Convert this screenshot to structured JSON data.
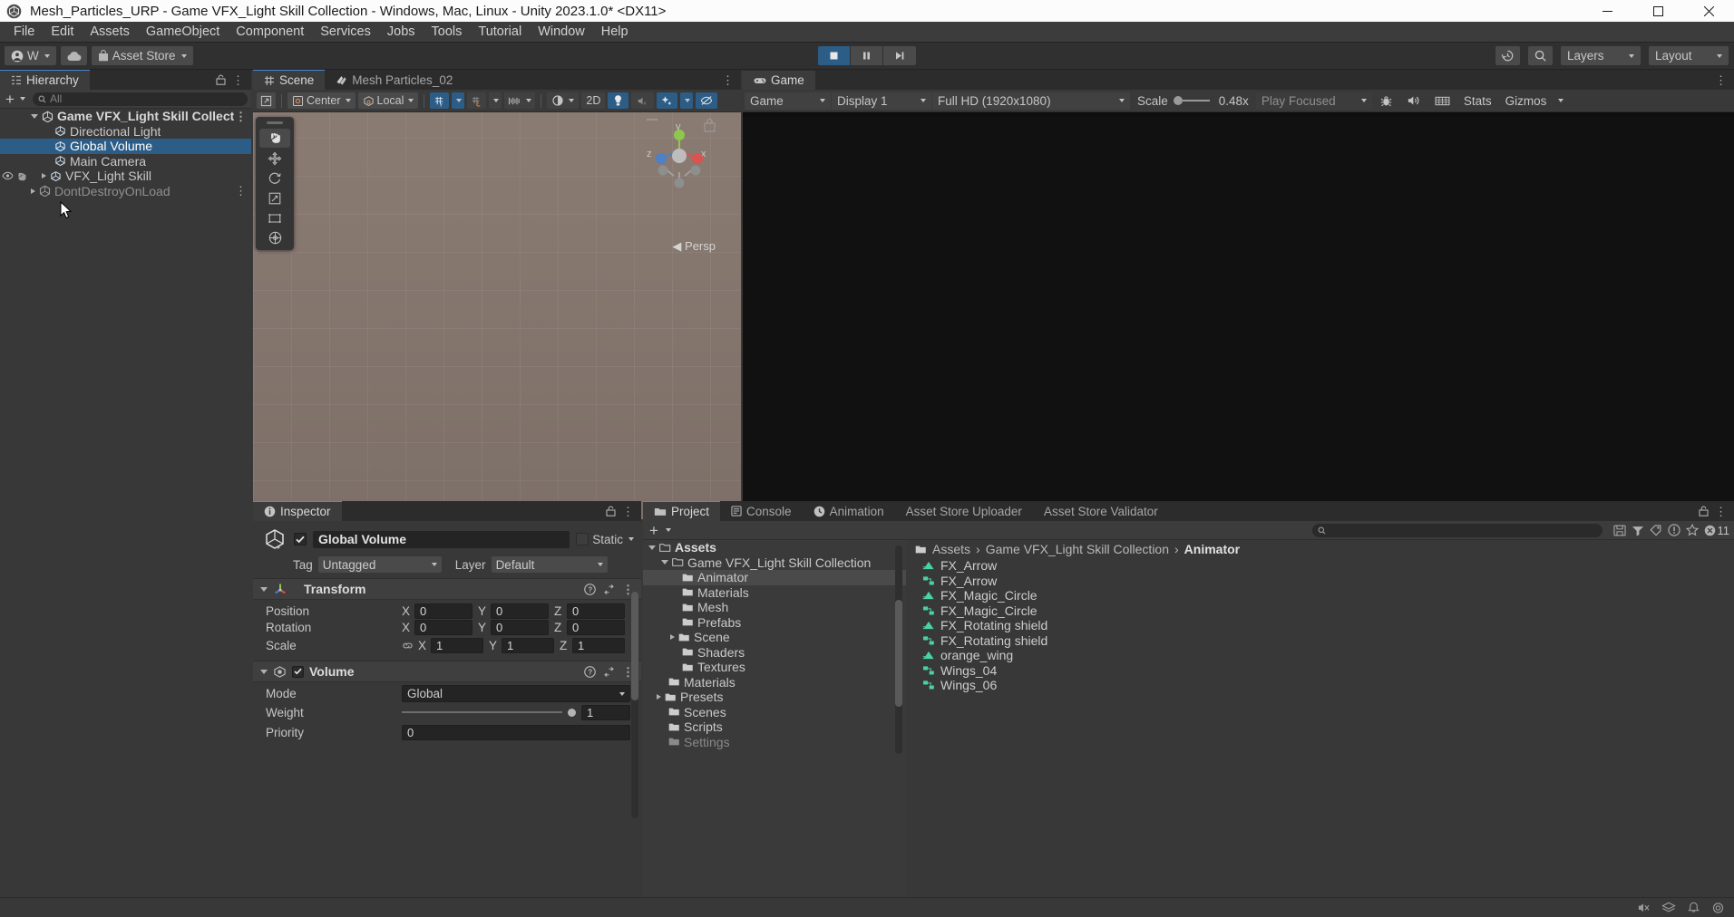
{
  "window": {
    "title": "Mesh_Particles_URP - Game VFX_Light Skill Collection - Windows, Mac, Linux - Unity 2023.1.0* <DX11>",
    "minimize_label": "Minimize",
    "maximize_label": "Maximize",
    "close_label": "Close"
  },
  "menubar": {
    "items": [
      "File",
      "Edit",
      "Assets",
      "GameObject",
      "Component",
      "Services",
      "Jobs",
      "Tools",
      "Tutorial",
      "Window",
      "Help"
    ]
  },
  "toolbar": {
    "account_label": "W",
    "cloud_label": "",
    "asset_store_label": "Asset Store",
    "play_label": "play-button",
    "pause_label": "pause-button",
    "step_label": "step-button",
    "history_label": "",
    "search_label": "",
    "layers_label": "Layers",
    "layout_label": "Layout"
  },
  "hierarchy": {
    "tab_label": "Hierarchy",
    "search_placeholder": "All",
    "add_label": "+",
    "items": [
      {
        "label": "Game VFX_Light Skill Collect",
        "depth": 0,
        "type": "scene",
        "expanded": true,
        "selected": false,
        "kebab": true
      },
      {
        "label": "Directional Light",
        "depth": 1,
        "type": "gameobject",
        "expanded": false,
        "selected": false,
        "kebab": false
      },
      {
        "label": "Global Volume",
        "depth": 1,
        "type": "gameobject",
        "expanded": false,
        "selected": true,
        "kebab": false
      },
      {
        "label": "Main Camera",
        "depth": 1,
        "type": "gameobject",
        "expanded": false,
        "selected": false,
        "kebab": false
      },
      {
        "label": "VFX_Light Skill",
        "depth": 1,
        "type": "gameobject",
        "expanded": false,
        "selected": false,
        "kebab": false,
        "hidden_icons": true,
        "collapsible": true
      },
      {
        "label": "DontDestroyOnLoad",
        "depth": 0,
        "type": "scene",
        "expanded": false,
        "selected": false,
        "kebab": true,
        "dim": true
      }
    ]
  },
  "scene": {
    "tabs": [
      {
        "label": "Scene",
        "icon": "grid-icon",
        "active": true
      },
      {
        "label": "Mesh Particles_02",
        "icon": "particles-icon",
        "active": false
      }
    ],
    "toolbar": {
      "pivot_label": "Center",
      "handle_label": "Local",
      "grid_snap_label": "grid-snap",
      "two_d_label": "2D",
      "lighting_label": "lighting-toggle",
      "audio_label": "audio-toggle",
      "fx_label": "effects-toggle",
      "hidden_label": "visibility-toggle"
    },
    "tools": [
      "hand-tool",
      "move-tool",
      "rotate-tool",
      "scale-tool",
      "rect-tool",
      "transform-tool"
    ],
    "gizmo": {
      "x": "x",
      "y": "y",
      "z": "z",
      "perspective_label": "◀ Persp"
    }
  },
  "game": {
    "tab_label": "Game",
    "toolbar": {
      "view_label": "Game",
      "display_label": "Display 1",
      "resolution_label": "Full HD (1920x1080)",
      "scale_label": "Scale",
      "scale_value": "0.48x",
      "play_mode_label": "Play Focused",
      "stats_label": "Stats",
      "gizmos_label": "Gizmos",
      "mute_label": "mute-audio",
      "aspect_label": "aspect"
    }
  },
  "inspector": {
    "tab_label": "Inspector",
    "object_name": "Global Volume",
    "enabled": true,
    "static_label": "Static",
    "tag_label": "Tag",
    "tag_value": "Untagged",
    "layer_label": "Layer",
    "layer_value": "Default",
    "components": [
      {
        "name": "Transform",
        "icon": "transform-icon",
        "has_checkbox": false,
        "rows": [
          {
            "label": "Position",
            "type": "vec3",
            "values": [
              "0",
              "0",
              "0"
            ]
          },
          {
            "label": "Rotation",
            "type": "vec3",
            "values": [
              "0",
              "0",
              "0"
            ]
          },
          {
            "label": "Scale",
            "type": "vec3",
            "values": [
              "1",
              "1",
              "1"
            ],
            "link": true
          }
        ]
      },
      {
        "name": "Volume",
        "icon": "volume-icon",
        "has_checkbox": true,
        "enabled": true,
        "rows": [
          {
            "label": "Mode",
            "type": "dropdown",
            "value": "Global"
          },
          {
            "label": "Weight",
            "type": "slider",
            "value": "1"
          },
          {
            "label": "Priority",
            "type": "field",
            "value": "0"
          }
        ]
      }
    ]
  },
  "project": {
    "tabs": [
      {
        "label": "Project",
        "icon": "folder-icon",
        "active": true
      },
      {
        "label": "Console",
        "icon": "console-icon",
        "active": false
      },
      {
        "label": "Animation",
        "icon": "clock-icon",
        "active": false
      },
      {
        "label": "Asset Store Uploader",
        "icon": "",
        "active": false
      },
      {
        "label": "Asset Store Validator",
        "icon": "",
        "active": false
      }
    ],
    "add_label": "+",
    "search_placeholder": "",
    "error_count": "11",
    "tree": [
      {
        "label": "Assets",
        "depth": 0,
        "expanded": true,
        "selected": false,
        "bold": true
      },
      {
        "label": "Game VFX_Light Skill Collection",
        "depth": 1,
        "expanded": true,
        "selected": false
      },
      {
        "label": "Animator",
        "depth": 2,
        "expanded": false,
        "selected": true
      },
      {
        "label": "Materials",
        "depth": 2,
        "expanded": false,
        "selected": false
      },
      {
        "label": "Mesh",
        "depth": 2,
        "expanded": false,
        "selected": false
      },
      {
        "label": "Prefabs",
        "depth": 2,
        "expanded": false,
        "selected": false
      },
      {
        "label": "Scene",
        "depth": 2,
        "expanded": false,
        "selected": false,
        "collapsible": true
      },
      {
        "label": "Shaders",
        "depth": 2,
        "expanded": false,
        "selected": false
      },
      {
        "label": "Textures",
        "depth": 2,
        "expanded": false,
        "selected": false
      },
      {
        "label": "Materials",
        "depth": 1,
        "expanded": false,
        "selected": false
      },
      {
        "label": "Presets",
        "depth": 1,
        "expanded": false,
        "selected": false,
        "collapsible": true
      },
      {
        "label": "Scenes",
        "depth": 1,
        "expanded": false,
        "selected": false
      },
      {
        "label": "Scripts",
        "depth": 1,
        "expanded": false,
        "selected": false
      },
      {
        "label": "Settings",
        "depth": 1,
        "expanded": false,
        "selected": false
      }
    ],
    "breadcrumb": [
      "Assets",
      "Game VFX_Light Skill Collection",
      "Animator"
    ],
    "assets": [
      {
        "label": "FX_Arrow",
        "icon": "animation-clip-icon"
      },
      {
        "label": "FX_Arrow",
        "icon": "animator-controller-icon"
      },
      {
        "label": "FX_Magic_Circle",
        "icon": "animation-clip-icon"
      },
      {
        "label": "FX_Magic_Circle",
        "icon": "animator-controller-icon"
      },
      {
        "label": "FX_Rotating shield",
        "icon": "animation-clip-icon"
      },
      {
        "label": "FX_Rotating shield",
        "icon": "animator-controller-icon"
      },
      {
        "label": "orange_wing",
        "icon": "animation-clip-icon"
      },
      {
        "label": "Wings_04",
        "icon": "animator-controller-icon"
      },
      {
        "label": "Wings_06",
        "icon": "animator-controller-icon"
      }
    ]
  },
  "colors": {
    "accent_blue": "#2c5d87",
    "tab_highlight": "#4b8bd4",
    "panel_bg": "#383838",
    "toolbar_bg": "#3c3c3c",
    "field_bg": "#242424",
    "anim_clip_green": "#4ad2a4"
  }
}
